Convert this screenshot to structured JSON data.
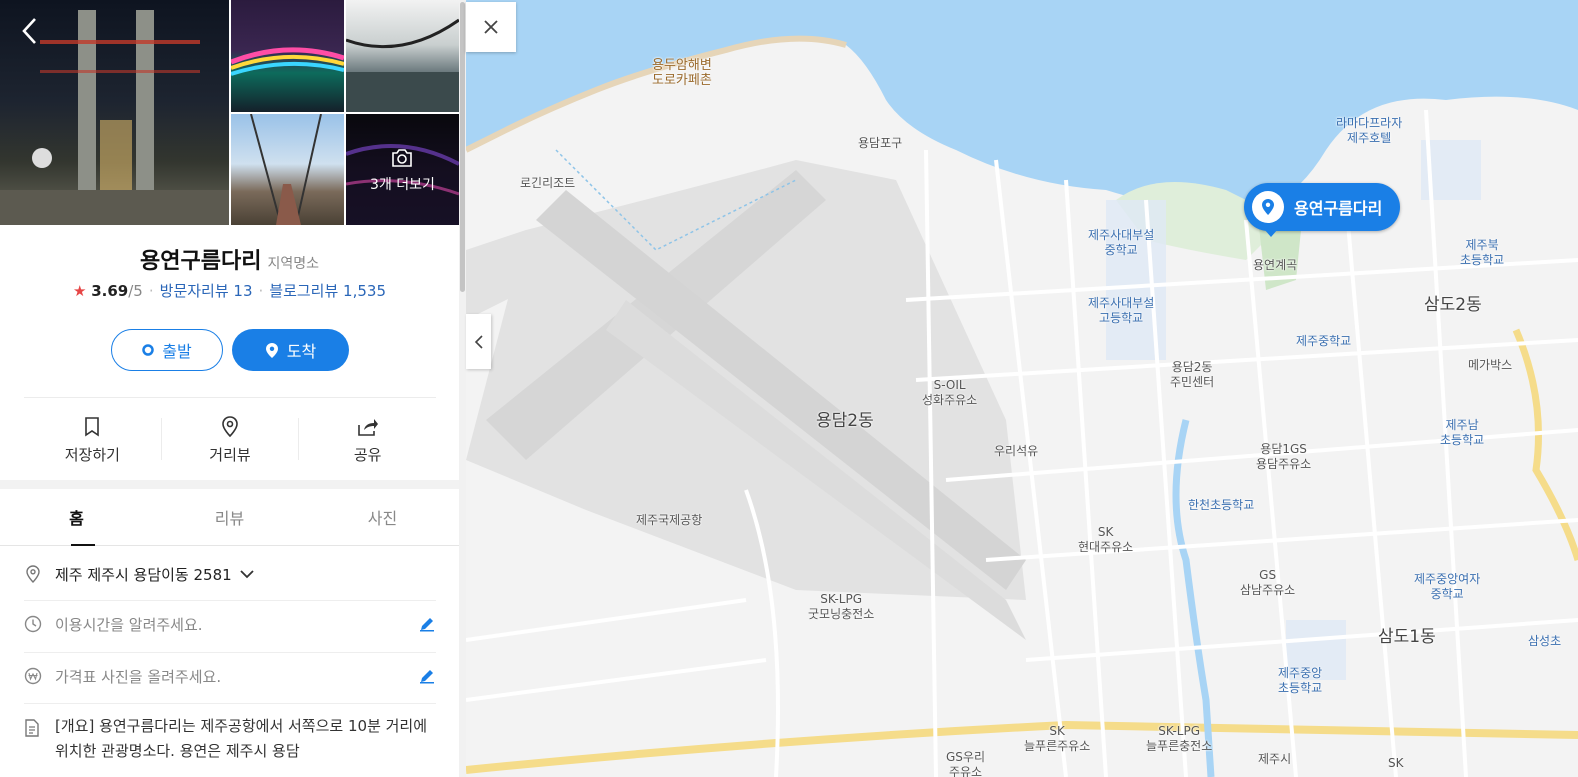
{
  "place": {
    "name": "용연구름다리",
    "category": "지역명소",
    "rating_star": "★",
    "rating": "3.69",
    "rating_max": "/5",
    "visitor_reviews": "방문자리뷰 13",
    "blog_reviews": "블로그리뷰 1,535"
  },
  "photos": {
    "more_label": "3개 더보기"
  },
  "buttons": {
    "departure": "출발",
    "arrival": "도착"
  },
  "actions": {
    "save": "저장하기",
    "streetview": "거리뷰",
    "share": "공유"
  },
  "tabs": [
    "홈",
    "리뷰",
    "사진"
  ],
  "info": {
    "address": "제주 제주시 용담이동 2581",
    "hours_prompt": "이용시간을 알려주세요.",
    "price_prompt": "가격표 사진을 올려주세요.",
    "description": "[개요] 용연구름다리는 제주공항에서 서쪽으로 10분 거리에 위치한 관광명소다. 용연은 제주시 용담"
  },
  "map": {
    "marker_label": "용연구름다리",
    "labels": {
      "yongduam": "용두암해변\n도로카페촌",
      "yongdampo": "용담포구",
      "logini": "로긴리조트",
      "ramada": "라마다프라자\n제주호텔",
      "jejusadae_mid": "제주사대부설\n중학교",
      "jejusadae_high": "제주사대부설\n고등학교",
      "yongyeon_gyegok": "용연계곡",
      "jejubuk": "제주북\n초등학교",
      "samdo2": "삼도2동",
      "jeju_middle": "제주중학교",
      "megabox": "메가박스",
      "soil": "S-OIL\n성화주유소",
      "yongdam2_center": "용담2동\n주민센터",
      "yongdam2": "용담2동",
      "uri_oil": "우리석유",
      "yongdam_gs": "용담1GS\n용담주유소",
      "jejunam": "제주남\n초등학교",
      "hancheon": "한천초등학교",
      "airport": "제주국제공항",
      "sk_hyundai": "SK\n현대주유소",
      "gs_samnam": "GS\n삼남주유소",
      "jeju_girls": "제주중앙여자\n중학교",
      "sklpg_gutmorning": "SK-LPG\n굿모닝충전소",
      "samdo1": "삼도1동",
      "jeju_central": "제주중앙\n초등학교",
      "samsung": "삼성초",
      "sk_neulpureun": "SK\n늘푸른주유소",
      "sklpg_neulpureun": "SK-LPG\n늘푸른충전소",
      "gs_uri": "GS우리\n주유소",
      "jejusi": "제주시",
      "sk_bottom": "SK"
    }
  },
  "colors": {
    "accent": "#1a7fe6",
    "sea": "#a8d4f5",
    "star": "#e64646",
    "link": "#2a66b8"
  }
}
